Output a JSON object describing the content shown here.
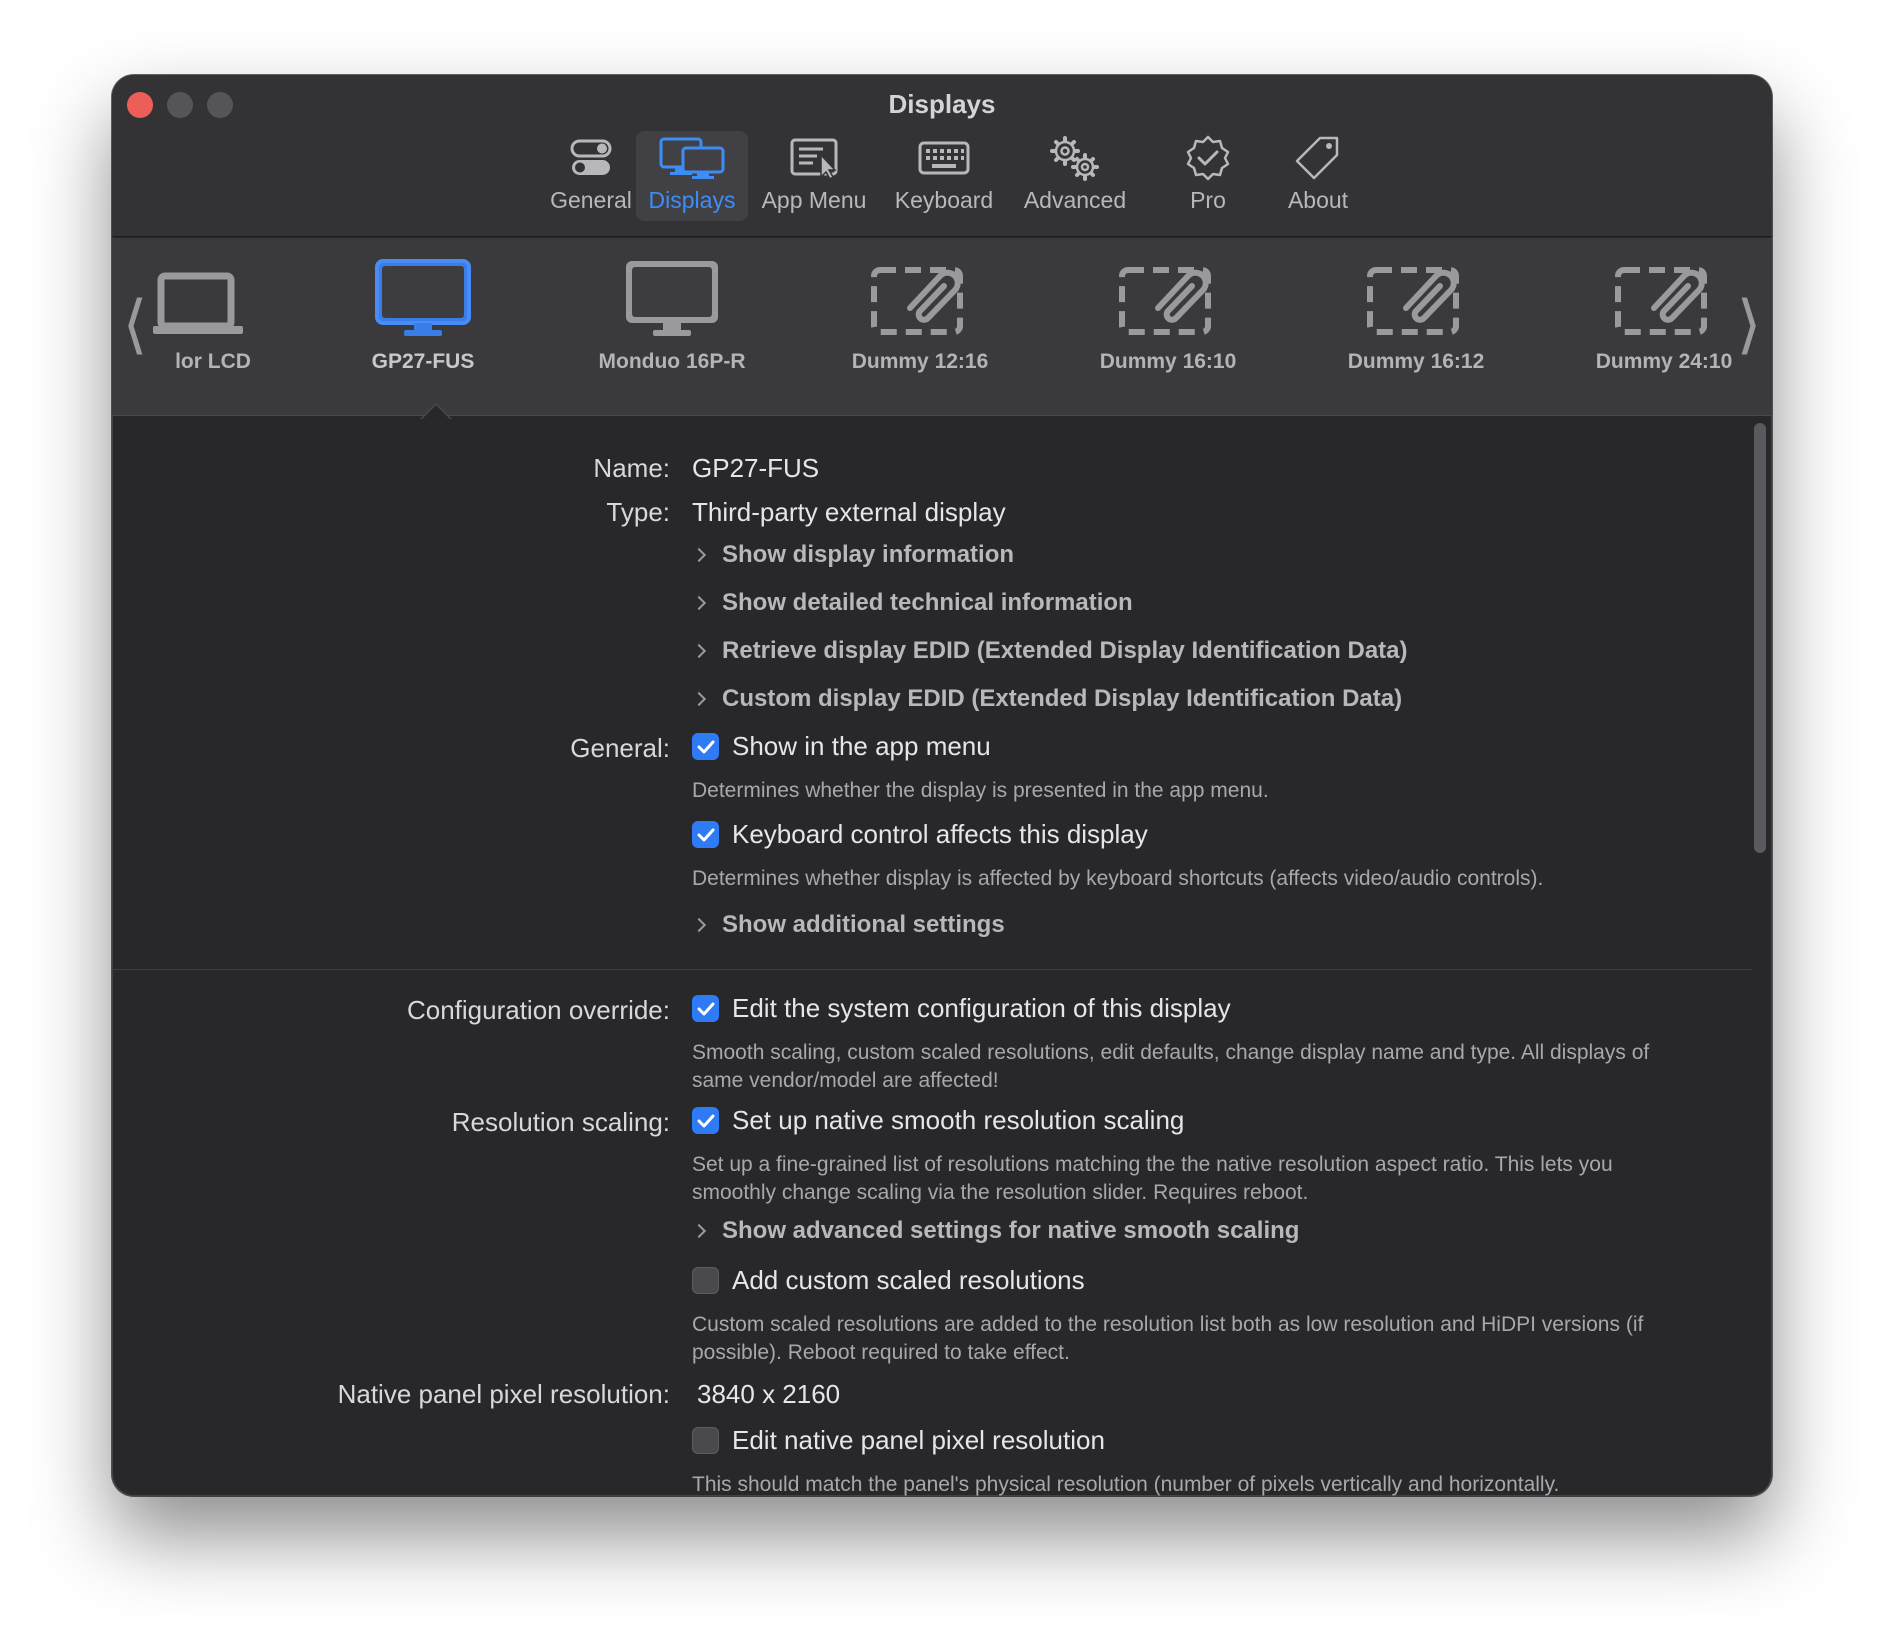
{
  "window": {
    "title": "Displays"
  },
  "toolbar": {
    "items": [
      {
        "label": "General",
        "icon": "toggles-icon"
      },
      {
        "label": "Displays",
        "icon": "displays-icon",
        "active": true
      },
      {
        "label": "App Menu",
        "icon": "app-menu-icon"
      },
      {
        "label": "Keyboard",
        "icon": "keyboard-icon"
      },
      {
        "label": "Advanced",
        "icon": "gears-icon"
      },
      {
        "label": "Pro",
        "icon": "pro-badge-icon"
      },
      {
        "label": "About",
        "icon": "tag-icon"
      }
    ]
  },
  "carousel": {
    "displays": [
      {
        "label": "lor LCD",
        "icon": "laptop-icon"
      },
      {
        "label": "GP27-FUS",
        "icon": "monitor-icon",
        "selected": true
      },
      {
        "label": "Monduo 16P-R",
        "icon": "monitor-icon"
      },
      {
        "label": "Dummy 12:16",
        "icon": "dummy-display-icon"
      },
      {
        "label": "Dummy 16:10",
        "icon": "dummy-display-icon"
      },
      {
        "label": "Dummy 16:12",
        "icon": "dummy-display-icon"
      },
      {
        "label": "Dummy 24:10",
        "icon": "dummy-display-icon"
      }
    ],
    "accent": "#3a7de8"
  },
  "details": {
    "name_label": "Name:",
    "name_value": "GP27-FUS",
    "type_label": "Type:",
    "type_value": "Third-party external display",
    "disclosures_info": [
      "Show display information",
      "Show detailed technical information",
      "Retrieve display EDID (Extended Display Identification Data)",
      "Custom display EDID (Extended Display Identification Data)"
    ],
    "general_label": "General:",
    "show_in_menu": {
      "label": "Show in the app menu",
      "checked": true,
      "help": "Determines whether the display is presented in the app menu."
    },
    "keyboard_control": {
      "label": "Keyboard control affects this display",
      "checked": true,
      "help": "Determines whether display is affected by keyboard shortcuts (affects video/audio controls)."
    },
    "additional_settings": "Show additional settings",
    "config_override_label": "Configuration override:",
    "config_override": {
      "label": "Edit the system configuration of this display",
      "checked": true,
      "help": "Smooth scaling, custom scaled resolutions, edit defaults, change display name and type. All displays of same vendor/model are affected!"
    },
    "resolution_scaling_label": "Resolution scaling:",
    "native_smooth": {
      "label": "Set up native smooth resolution scaling",
      "checked": true,
      "help": "Set up a fine-grained list of resolutions matching the the native resolution aspect ratio. This lets you smoothly change scaling via the resolution slider. Requires reboot."
    },
    "advanced_native": "Show advanced settings for native smooth scaling",
    "custom_scaled": {
      "label": "Add custom scaled resolutions",
      "checked": false,
      "help": "Custom scaled resolutions are added to the resolution list both as low resolution and HiDPI versions (if possible). Reboot required to take effect."
    },
    "native_res_label": "Native panel pixel resolution:",
    "native_res_value": "3840 x 2160",
    "edit_native": {
      "label": "Edit native panel pixel resolution",
      "checked": false,
      "help": "This should match the panel's physical resolution (number of pixels vertically and horizontally."
    }
  }
}
